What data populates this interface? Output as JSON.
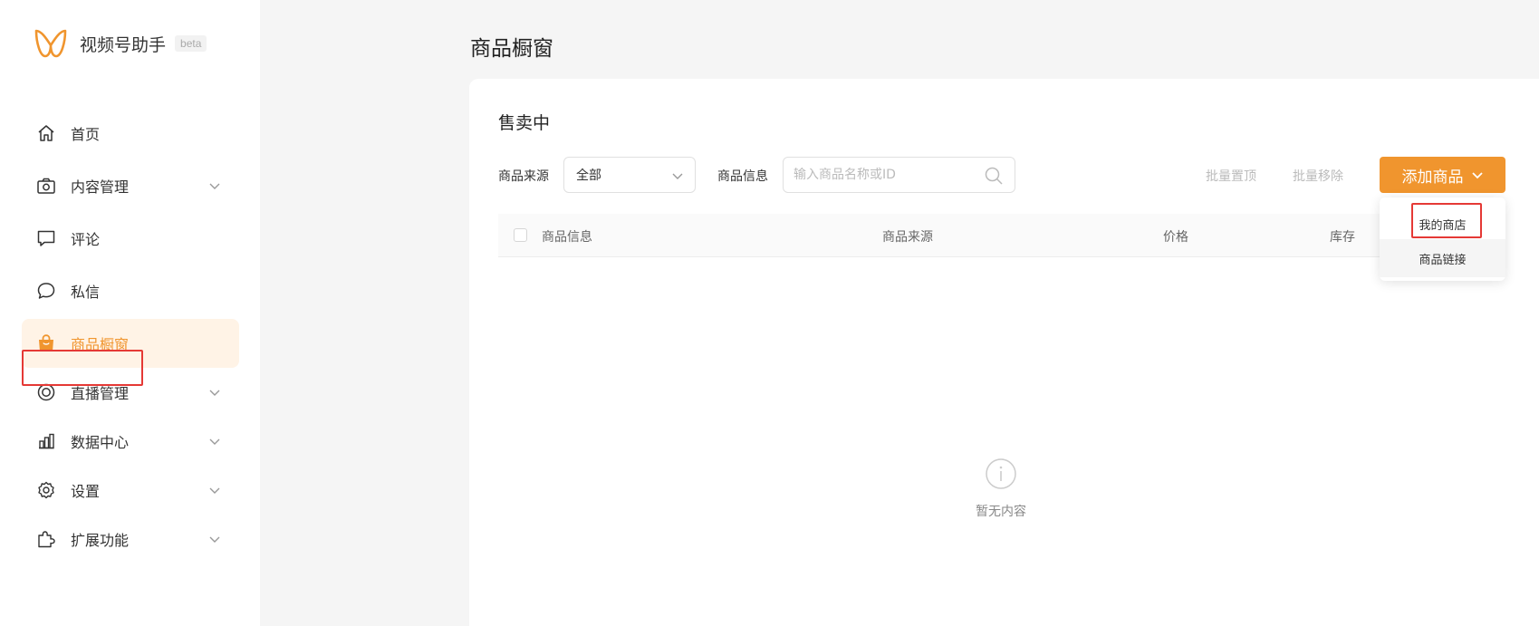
{
  "brand": {
    "title": "视频号助手",
    "badge": "beta"
  },
  "sidebar": {
    "items": [
      {
        "label": "首页",
        "icon": "home-icon"
      },
      {
        "label": "内容管理",
        "icon": "camera-icon",
        "expandable": true
      },
      {
        "label": "评论",
        "icon": "comment-icon"
      },
      {
        "label": "私信",
        "icon": "message-icon"
      },
      {
        "label": "商品橱窗",
        "icon": "shopping-bag-icon",
        "active": true
      },
      {
        "label": "直播管理",
        "icon": "live-icon",
        "expandable": true
      },
      {
        "label": "数据中心",
        "icon": "chart-icon",
        "expandable": true
      },
      {
        "label": "设置",
        "icon": "gear-icon",
        "expandable": true
      },
      {
        "label": "扩展功能",
        "icon": "puzzle-icon",
        "expandable": true
      }
    ]
  },
  "page": {
    "title": "商品橱窗"
  },
  "section": {
    "title": "售卖中"
  },
  "filters": {
    "source_label": "商品来源",
    "source_value": "全部",
    "info_label": "商品信息",
    "search_placeholder": "输入商品名称或ID"
  },
  "actions": {
    "batch_top": "批量置顶",
    "batch_remove": "批量移除",
    "add_product": "添加商品"
  },
  "table": {
    "columns": [
      "商品信息",
      "商品来源",
      "价格",
      "库存"
    ]
  },
  "empty": {
    "text": "暂无内容"
  },
  "dropdown": {
    "items": [
      "我的商店",
      "商品链接"
    ]
  },
  "colors": {
    "accent": "#f0952e",
    "active_bg": "#fff3e6",
    "highlight": "#e53935"
  }
}
